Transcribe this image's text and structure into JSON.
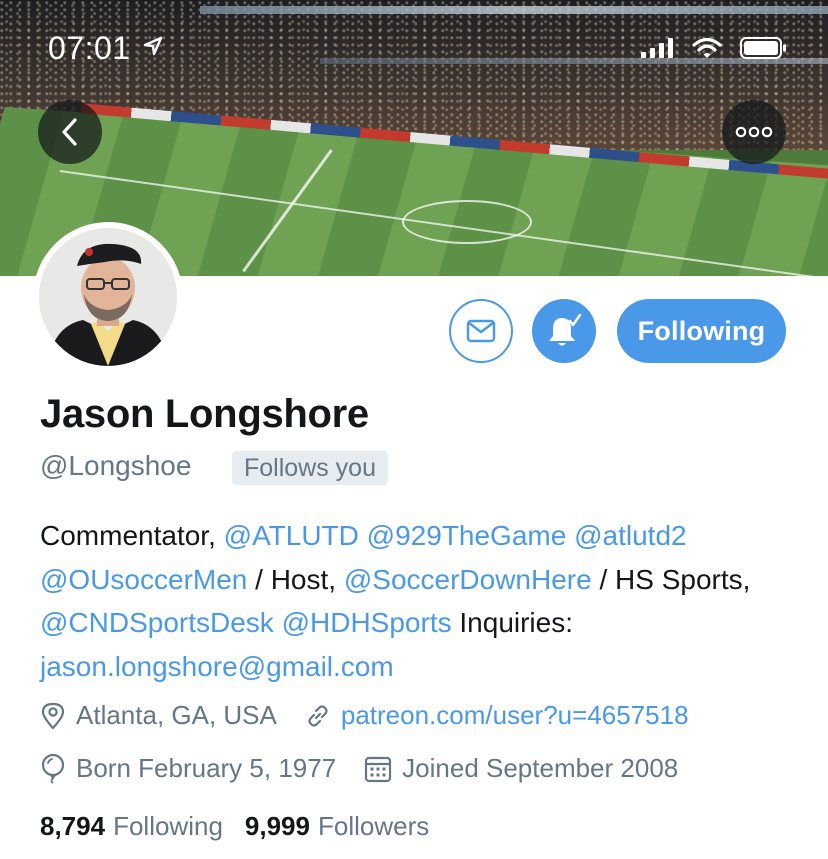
{
  "status_bar": {
    "time": "07:01"
  },
  "profile": {
    "display_name": "Jason Longshore",
    "handle": "@Longshoe",
    "follows_you": "Follows you",
    "following_button": "Following"
  },
  "bio": {
    "segments": [
      {
        "text": "Commentator, ",
        "type": "text"
      },
      {
        "text": "@ATLUTD",
        "type": "mention"
      },
      {
        "text": " ",
        "type": "text"
      },
      {
        "text": "@929TheGame",
        "type": "mention"
      },
      {
        "text": " ",
        "type": "text"
      },
      {
        "text": "@atlutd2",
        "type": "mention"
      },
      {
        "text": " ",
        "type": "text"
      },
      {
        "text": "@OUsoccerMen",
        "type": "mention"
      },
      {
        "text": " / Host, ",
        "type": "text"
      },
      {
        "text": "@SoccerDownHere",
        "type": "mention"
      },
      {
        "text": " / HS Sports, ",
        "type": "text"
      },
      {
        "text": "@CNDSportsDesk",
        "type": "mention"
      },
      {
        "text": " ",
        "type": "text"
      },
      {
        "text": "@HDHSports",
        "type": "mention"
      },
      {
        "text": " Inquiries: ",
        "type": "text"
      },
      {
        "text": "jason.longshore@gmail.com",
        "type": "mention"
      }
    ]
  },
  "meta": {
    "location": "Atlanta, GA, USA",
    "website": "patreon.com/user?u=4657518",
    "birthday": "Born February 5, 1977",
    "joined": "Joined September 2008"
  },
  "counts": {
    "following_num": "8,794",
    "following_label": "Following",
    "followers_num": "9,999",
    "followers_label": "Followers"
  },
  "colors": {
    "accent": "#4a99e9",
    "secondary_text": "#657786",
    "primary_text": "#14171a"
  },
  "icons": {
    "back": "chevron-left-icon",
    "more": "more-dots-icon",
    "message": "envelope-icon",
    "notifications": "bell-check-icon",
    "location": "location-pin-icon",
    "website": "link-icon",
    "birthday": "balloon-icon",
    "joined": "calendar-icon"
  }
}
